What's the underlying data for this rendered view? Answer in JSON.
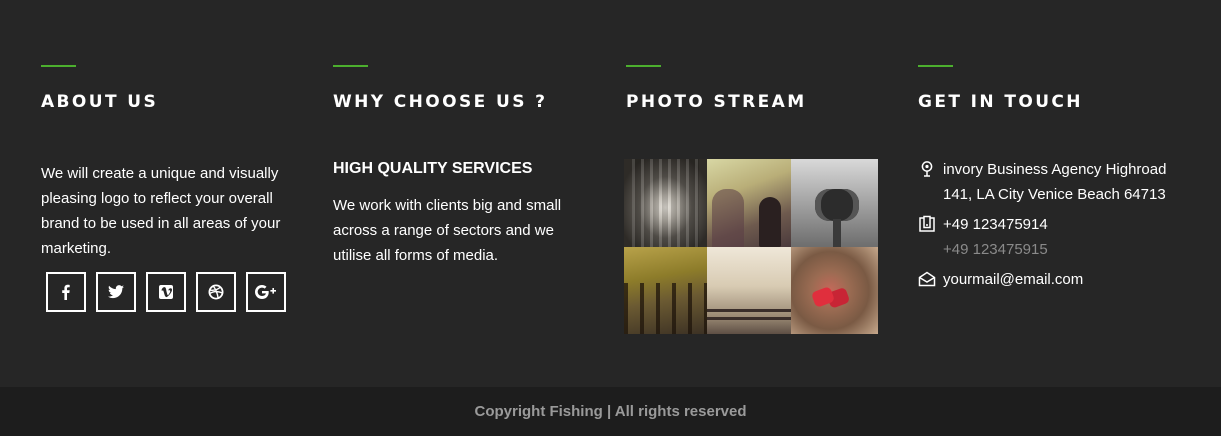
{
  "about": {
    "title": "ABOUT US",
    "text": "We will create a unique and visually pleasing logo to reflect your overall brand to be used in all areas of your marketing.",
    "social": [
      {
        "icon": "facebook-icon"
      },
      {
        "icon": "twitter-icon"
      },
      {
        "icon": "vimeo-icon"
      },
      {
        "icon": "dribbble-icon"
      },
      {
        "icon": "google-plus-icon"
      }
    ]
  },
  "why": {
    "title": "WHY CHOOSE US ?",
    "heading": "HIGH QUALITY SERVICES",
    "text": "We work with clients big and small across a range of sectors and we utilise all forms of media."
  },
  "photo": {
    "title": "PHOTO STREAM"
  },
  "contact": {
    "title": "GET IN TOUCH",
    "address_line1": "invory Business Agency Highroad",
    "address_line2": "141, LA City Venice Beach 64713",
    "phone": "+49 123475914",
    "phone_alt": "+49 123475915",
    "email": "yourmail@email.com"
  },
  "footer": {
    "copyright": "Copyright Fishing | All rights reserved"
  },
  "colors": {
    "background": "#262626",
    "bottom_bar": "#1d1d1d",
    "accent": "#4caf2e"
  }
}
